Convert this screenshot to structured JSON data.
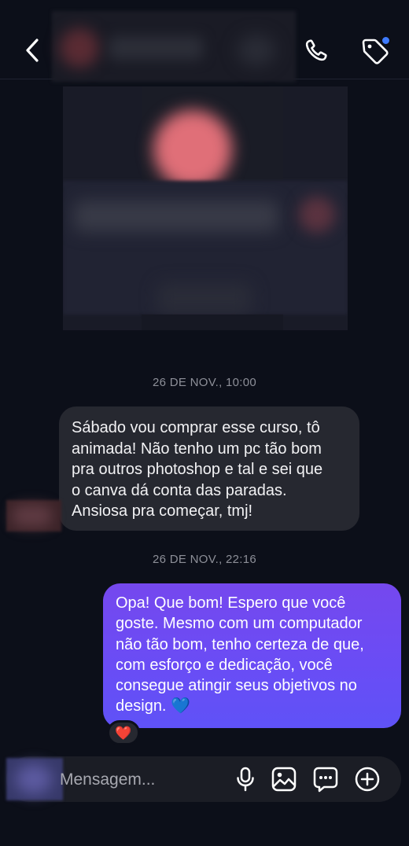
{
  "header": {
    "back_icon": "chevron-left-icon",
    "call_icon": "phone-icon",
    "tag_icon": "tag-icon",
    "notification_dot_color": "#3e7bff"
  },
  "messages": [
    {
      "timestamp": "26 DE NOV., 10:00",
      "direction": "received",
      "lines": [
        "Sábado vou comprar esse curso, tô",
        "animada! Não tenho um pc tão bom",
        "pra outros photoshop e tal e sei que",
        "o canva dá conta das paradas.",
        "Ansiosa pra começar, tmj!"
      ]
    },
    {
      "timestamp": "26 DE NOV., 22:16",
      "direction": "sent",
      "lines": [
        "Opa! Que bom! Espero que você",
        "goste. Mesmo com um computador",
        "não tão bom, tenho certeza de que,",
        "com esforço e dedicação, você",
        "consegue atingir seus objetivos no",
        "design. 💙"
      ],
      "reaction": "❤️"
    }
  ],
  "composer": {
    "placeholder": "Mensagem...",
    "icons": [
      "microphone-icon",
      "image-icon",
      "sticker-icon",
      "plus-icon"
    ]
  },
  "colors": {
    "background": "#0c0f19",
    "received_bubble": "#262830",
    "sent_bubble_top": "#7548ee",
    "sent_bubble_bottom": "#5f52f7"
  }
}
